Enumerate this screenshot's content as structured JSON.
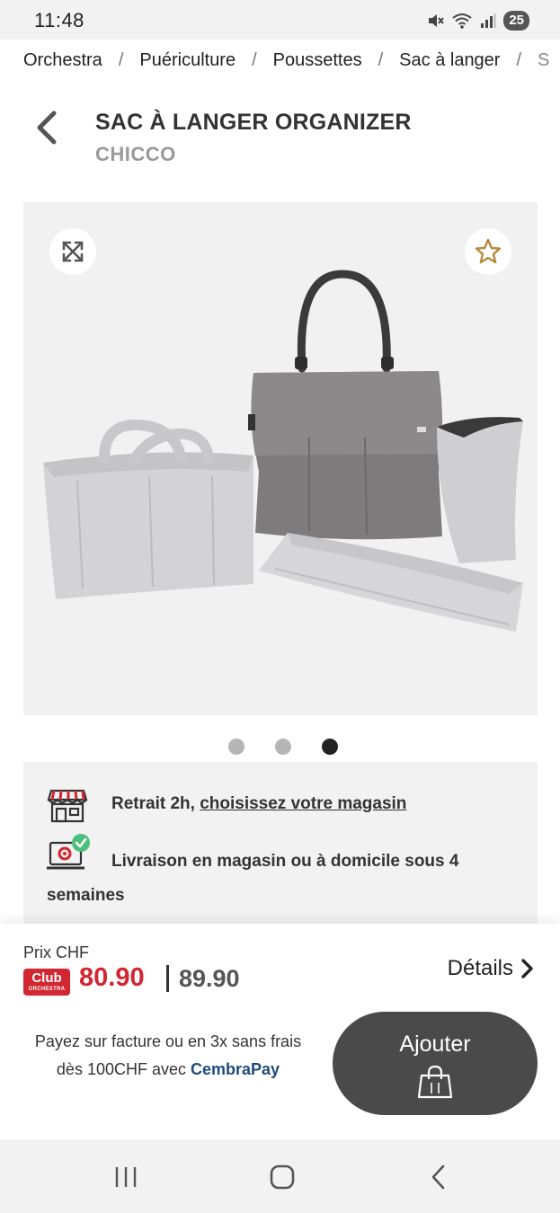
{
  "status": {
    "time": "11:48",
    "battery": "25"
  },
  "breadcrumb": [
    "Orchestra",
    "Puériculture",
    "Poussettes",
    "Sac à langer",
    "S"
  ],
  "product": {
    "title": "SAC À LANGER ORGANIZER",
    "brand": "CHICCO"
  },
  "gallery": {
    "total_images": 3,
    "active_index": 2
  },
  "info": {
    "pickup_prefix": "Retrait 2h, ",
    "pickup_link": "choisissez votre magasin",
    "delivery": "Livraison en magasin ou à domicile sous 4 semaines"
  },
  "price": {
    "label": "Prix CHF",
    "club_line1": "Club",
    "club_line2": "ORCHESTRA",
    "club_price": "80.90",
    "regular_price": "89.90",
    "details_label": "Détails"
  },
  "payment": {
    "text": "Payez sur facture ou en 3x sans frais dès 100CHF avec ",
    "provider": "CembraPay"
  },
  "cart": {
    "add_label": "Ajouter"
  },
  "colors": {
    "accent_red": "#d22630",
    "button_dark": "#4a4a4a",
    "cembra_blue": "#1e4a7a"
  }
}
